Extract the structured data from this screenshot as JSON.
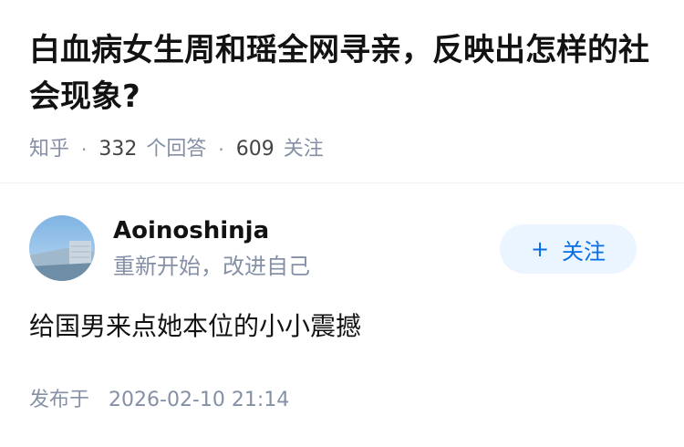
{
  "question": {
    "title": "白血病女生周和瑶全网寻亲，反映出怎样的社会现象?",
    "source": "知乎",
    "answer_count": "332",
    "answer_label": "个回答",
    "follower_count": "609",
    "follower_label": "关注"
  },
  "answer": {
    "author_name": "Aoinoshinja",
    "author_bio": "重新开始，改进自己",
    "follow_button_plus": "+",
    "follow_button_label": "关注",
    "content": "给国男来点她本位的小小震撼",
    "publish_label": "发布于",
    "publish_time": "2026-02-10 21:14"
  },
  "colors": {
    "accent": "#056de8",
    "accent_bg": "#ebf5ff",
    "muted_text": "#8590a6",
    "primary_text": "#121212"
  }
}
